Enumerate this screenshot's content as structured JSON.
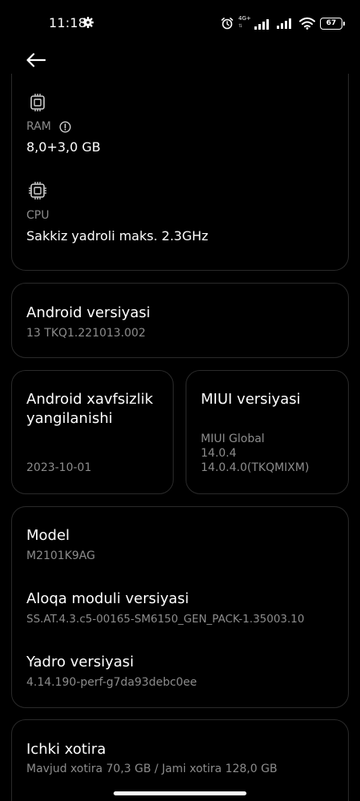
{
  "status_bar": {
    "time": "11:18",
    "network_label": "4G+",
    "battery": "67"
  },
  "hardware": {
    "ram_label": "RAM",
    "ram_value": "8,0+3,0 GB",
    "cpu_label": "CPU",
    "cpu_value": "Sakkiz yadroli maks. 2.3GHz"
  },
  "android": {
    "title": "Android versiyasi",
    "value": "13 TKQ1.221013.002"
  },
  "security": {
    "title_line1": "Android xavfsizlik",
    "title_line2": "yangilanishi",
    "value": "2023-10-01"
  },
  "miui": {
    "title": "MIUI versiyasi",
    "line1": "MIUI Global",
    "line2": "14.0.4",
    "line3": "14.0.4.0(TKQMIXM)"
  },
  "model": {
    "model_title": "Model",
    "model_value": "M2101K9AG",
    "baseband_title": "Aloqa moduli versiyasi",
    "baseband_value": "SS.AT.4.3.c5-00165-SM6150_GEN_PACK-1.35003.10",
    "kernel_title": "Yadro versiyasi",
    "kernel_value": "4.14.190-perf-g7da93debc0ee"
  },
  "storage": {
    "title": "Ichki xotira",
    "value": "Mavjud xotira  70,3 GB / Jami xotira  128,0 GB"
  },
  "icons": {
    "back": "arrow-left-icon",
    "chip": "chip-icon",
    "info": "info-icon"
  }
}
